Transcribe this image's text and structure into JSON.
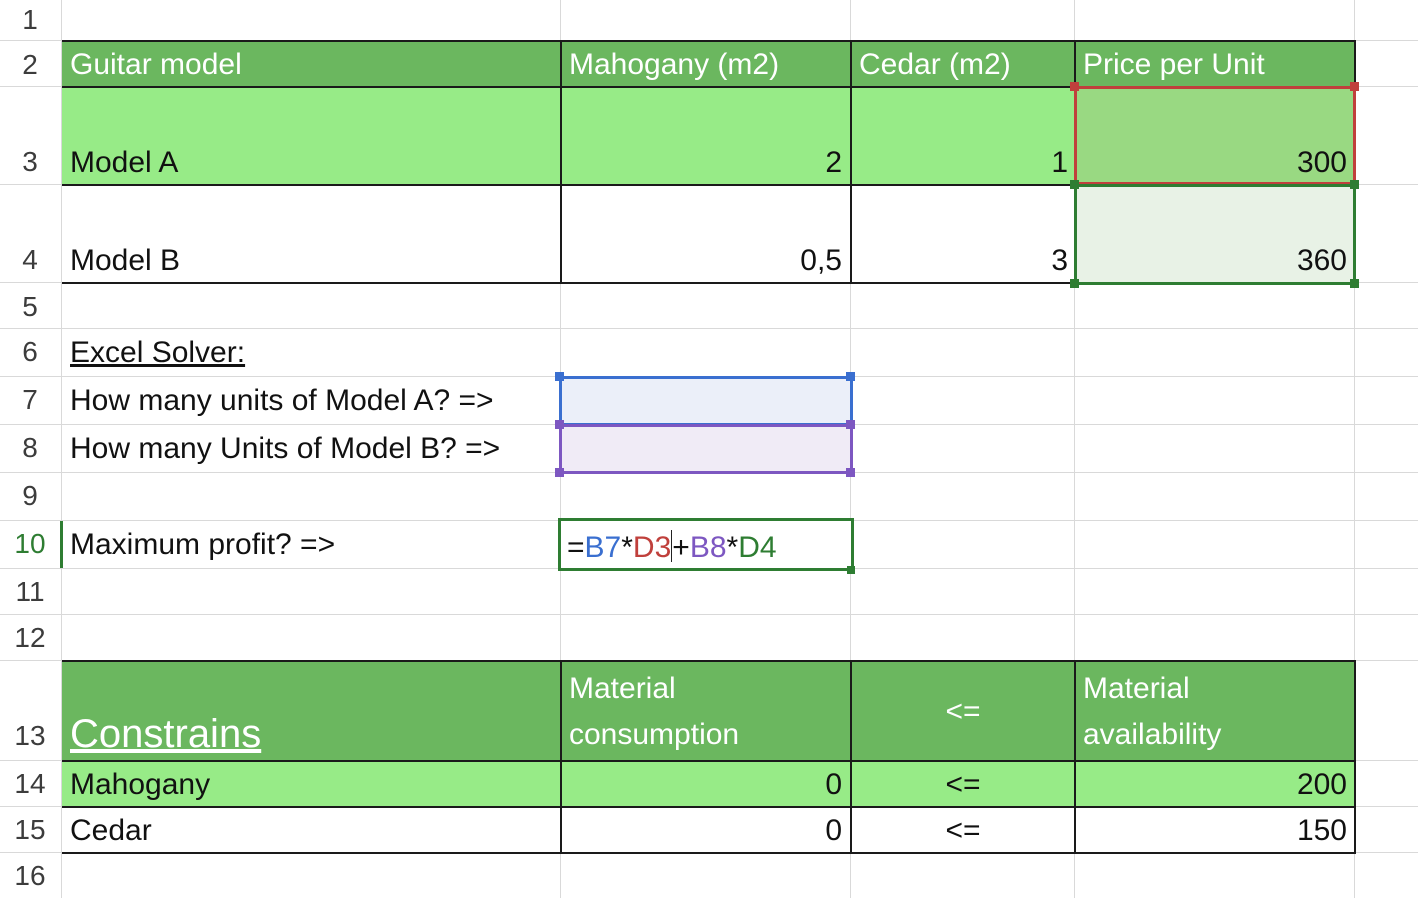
{
  "row_numbers": [
    "1",
    "2",
    "3",
    "4",
    "5",
    "6",
    "7",
    "8",
    "9",
    "10",
    "11",
    "12",
    "13",
    "14",
    "15",
    "16"
  ],
  "models_table": {
    "headers": [
      "Guitar model",
      "Mahogany (m2)",
      "Cedar (m2)",
      "Price per Unit"
    ],
    "rows": [
      {
        "model": "Model A",
        "mahogany": "2",
        "cedar": "1",
        "price": "300"
      },
      {
        "model": "Model B",
        "mahogany": "0,5",
        "cedar": "3",
        "price": "360"
      }
    ]
  },
  "solver": {
    "title": "Excel Solver:",
    "question_a": "How many units of Model A? =>",
    "question_b": "How many Units of Model B? =>",
    "max_profit_label": "Maximum profit? =>",
    "formula": {
      "eq": "=",
      "ref1": "B7",
      "op1": "*",
      "ref2": "D3",
      "op2": "+",
      "ref3": "B8",
      "op3": "*",
      "ref4": "D4"
    }
  },
  "constraints_table": {
    "title": "Constrains",
    "header_consumption_line1": "Material",
    "header_consumption_line2": "consumption",
    "header_op": "<=",
    "header_availability_line1": "Material",
    "header_availability_line2": "availability",
    "rows": [
      {
        "material": "Mahogany",
        "consumption": "0",
        "op": "<=",
        "availability": "200"
      },
      {
        "material": "Cedar",
        "consumption": "0",
        "op": "<=",
        "availability": "150"
      }
    ]
  },
  "colors": {
    "header_green": "#6bb75f",
    "row_green": "#97eb87",
    "price_selected": "#99d982",
    "price_b_selected": "#e8f2e6",
    "ref_blue": "#3a6fd0",
    "ref_red": "#c0403c",
    "ref_purple": "#7d57c1",
    "ref_green": "#2e7d32"
  }
}
